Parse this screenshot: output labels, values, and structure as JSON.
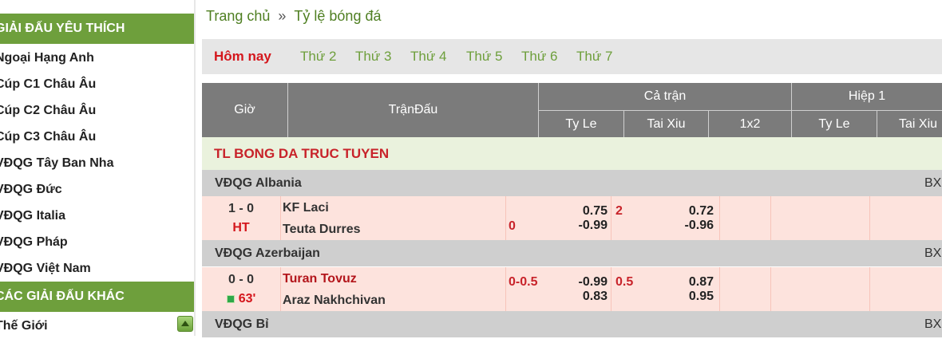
{
  "sidebar": {
    "favorites_title": "GIẢI ĐẤU YÊU THÍCH",
    "favorites": [
      "Ngoại Hạng Anh",
      "Cúp C1 Châu Âu",
      "Cúp C2 Châu Âu",
      "Cúp C3 Châu Âu",
      "VĐQG Tây Ban Nha",
      "VĐQG Đức",
      "VĐQG Italia",
      "VĐQG Pháp",
      "VĐQG Việt Nam"
    ],
    "others_title": "CÁC GIẢI ĐẤU KHÁC",
    "others": [
      "Thế Giới"
    ]
  },
  "breadcrumb": {
    "home": "Trang chủ",
    "separator": "»",
    "current": "Tỷ lệ bóng đá"
  },
  "day_tabs": [
    "Hôm nay",
    "Thứ 2",
    "Thứ 3",
    "Thứ 4",
    "Thứ 5",
    "Thứ 6",
    "Thứ 7"
  ],
  "table_header": {
    "time": "Giờ",
    "match": "TrậnĐấu",
    "full_match": "Cả trận",
    "first_half": "Hiệp 1",
    "sub": [
      "Ty Le",
      "Tai Xiu",
      "1x2",
      "Ty Le",
      "Tai Xiu"
    ]
  },
  "section_title": "TL BONG DA TRUC TUYEN",
  "leagues": [
    {
      "name": "VĐQG Albania",
      "bx": "BX"
    },
    {
      "name": "VĐQG Azerbaijan",
      "bx": "BX"
    },
    {
      "name": "VĐQG Bỉ",
      "bx": "BX"
    }
  ],
  "matches": [
    {
      "score": "1 - 0",
      "status": "HT",
      "home": "KF Laci",
      "away": "Teuta Durres",
      "handicap": "0",
      "handicap_home_odds": "0.75",
      "handicap_away_odds": "-0.99",
      "ou_line": "2",
      "ou_over_odds": "0.72",
      "ou_under_odds": "-0.96"
    },
    {
      "score": "0 - 0",
      "status": "63'",
      "home": "Turan Tovuz",
      "away": "Araz Nakhchivan",
      "handicap": "0-0.5",
      "handicap_home_odds": "-0.99",
      "handicap_away_odds": "0.83",
      "ou_line": "0.5",
      "ou_over_odds": "0.87",
      "ou_under_odds": "0.95"
    }
  ],
  "colors": {
    "sidebar_header_bg": "#6e9f3c",
    "table_header_bg": "#7b7b7b",
    "accent_red": "#d4161c",
    "link_green": "#6e9f3c",
    "row_bg": "#fde3dd",
    "league_bg": "#cfcfcf"
  }
}
